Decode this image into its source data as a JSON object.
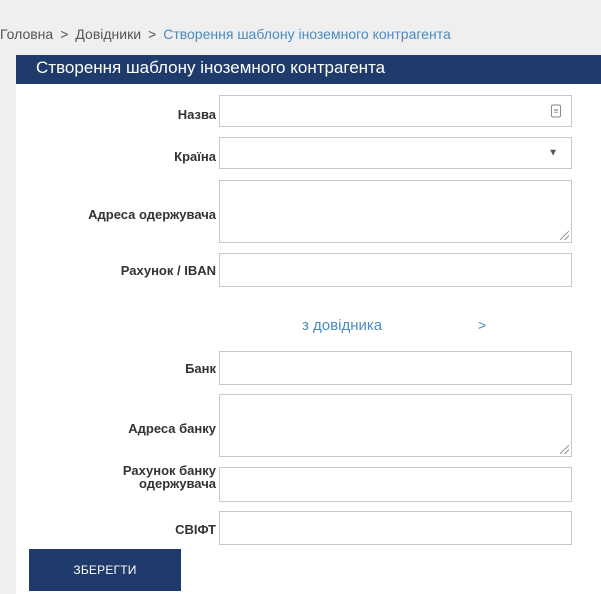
{
  "breadcrumb": {
    "items": [
      "Головна",
      "Довідники",
      "Створення шаблону іноземного контрагента"
    ],
    "separator": ">"
  },
  "page": {
    "title": "Створення шаблону іноземного контрагента"
  },
  "form": {
    "name": {
      "label": "Назва",
      "value": "",
      "icon": "contact-card-icon"
    },
    "country": {
      "label": "Країна",
      "value": ""
    },
    "recipient_address": {
      "label": "Адреса одержувача",
      "value": ""
    },
    "account": {
      "label": "Рахунок / IBAN",
      "value": ""
    },
    "directory_link": {
      "label": "з довідника",
      "arrow": ">"
    },
    "bank": {
      "label": "Банк",
      "value": ""
    },
    "bank_address": {
      "label": "Адреса банку",
      "value": ""
    },
    "bank_account_line1": "Рахунок банку",
    "bank_account_line2": "одержувача",
    "bank_account_value": "",
    "swift": {
      "label": "СВІФТ",
      "value": ""
    }
  },
  "actions": {
    "save_label": "ЗБЕРЕГТИ"
  },
  "colors": {
    "header_bg": "#1f3b6c",
    "link": "#4a8bc2",
    "page_bg": "#efeff0"
  }
}
